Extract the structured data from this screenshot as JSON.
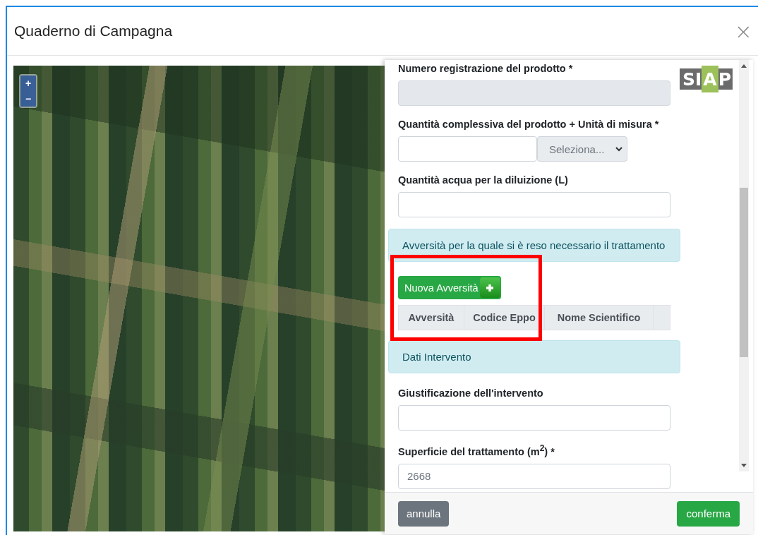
{
  "window": {
    "title": "Quaderno di Campagna",
    "close": "×"
  },
  "map": {
    "zoom_in": "+",
    "zoom_out": "−"
  },
  "logo": {
    "text": "SIAP"
  },
  "form": [
    {
      "kind": "input",
      "label": "Numero registrazione del prodotto *",
      "disabled": true
    },
    {
      "kind": "input-select",
      "label": "Quantità complessiva del prodotto + Unità di misura *",
      "select": "Seleziona..."
    },
    {
      "kind": "input",
      "label": "Quantità acqua per la diluizione (L)",
      "disabled": false
    },
    {
      "kind": "section",
      "text": "Avversità per la quale si è reso necessario il trattamento"
    },
    {
      "kind": "table",
      "button": "Nuova Avversità",
      "columns": [
        "Avversità",
        "Codice Eppo",
        "Nome Scientifico"
      ],
      "highlighted": true
    },
    {
      "kind": "section",
      "text": "Dati Intervento"
    },
    {
      "kind": "input",
      "label": "Giustificazione dell'intervento",
      "disabled": false
    },
    {
      "kind": "input",
      "label": "Superficie del trattamento (m$^{2}$) *",
      "value": "2668",
      "disabled": false
    }
  ],
  "footer": {
    "cancel": "annulla",
    "confirm": "conferma"
  }
}
